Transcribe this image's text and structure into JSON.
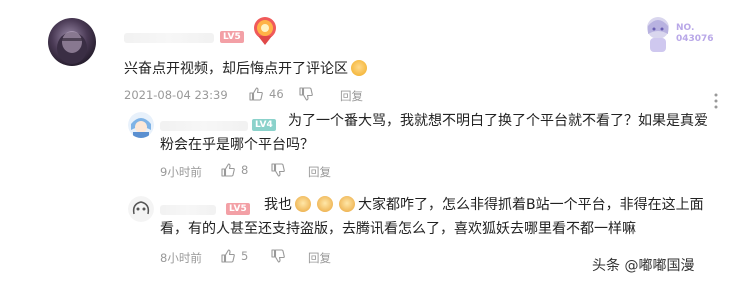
{
  "comment": {
    "level_badge": "LV5",
    "text": "兴奋点开视频，却后悔点开了评论区",
    "emoji": "blush-emoji",
    "date": "2021-08-04 23:39",
    "likes": "46",
    "reply_label": "回复"
  },
  "fan_badge": {
    "text_line1": "NO.",
    "text_line2": "043076"
  },
  "replies": [
    {
      "level_badge": "LV4",
      "text_line1": "为了一个番大骂，我就想不明白了换了个平台就不看了？如果是真爱",
      "text_line2": "粉会在乎是哪个平台吗？",
      "time": "9小时前",
      "likes": "8",
      "reply_label": "回复"
    },
    {
      "level_badge": "LV5",
      "text_prefix": "我也",
      "text_after_emojis": "大家都咋了，怎么非得抓着B站一个平台，非得在这上面",
      "text_line2": "看，有的人甚至还支持盗版，去腾讯看怎么了，喜欢狐妖去哪里看不都一样嘛",
      "time": "8小时前",
      "likes": "5",
      "reply_label": "回复"
    }
  ],
  "watermark": {
    "text": "头条 @嘟嘟国漫"
  },
  "colors": {
    "meta": "#999999",
    "text": "#222222",
    "lv5": "#f3a0a6",
    "lv4": "#8bd2cb"
  }
}
